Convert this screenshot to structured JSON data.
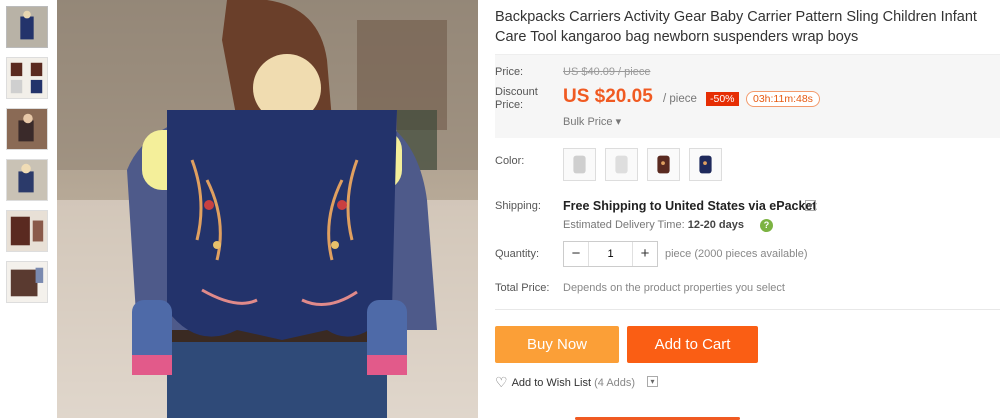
{
  "product": {
    "title": "Backpacks Carriers Activity Gear Baby Carrier Pattern Sling Children Infant Care Tool kangaroo bag newborn suspenders wrap boys"
  },
  "price": {
    "label": "Price:",
    "original": "US $40.09 / piece",
    "discount_label": "Discount Price:",
    "discount": "US $20.05",
    "unit": "/ piece",
    "off": "-50%",
    "timer": "03h:11m:48s",
    "bulk": "Bulk Price ▾"
  },
  "color": {
    "label": "Color:",
    "swatches": [
      {
        "name": "light-gray",
        "hex": "#cfcfcf"
      },
      {
        "name": "gray-white",
        "hex": "#dedede"
      },
      {
        "name": "brown",
        "hex": "#5a2a20"
      },
      {
        "name": "navy",
        "hex": "#1f2a5c"
      }
    ]
  },
  "shipping": {
    "label": "Shipping:",
    "main": "Free Shipping to United States via ePacket",
    "estimate_prefix": "Estimated Delivery Time:",
    "estimate_days": "12-20 days"
  },
  "quantity": {
    "label": "Quantity:",
    "value": "1",
    "minus": "−",
    "plus": "+",
    "available": "piece (2000 pieces available)"
  },
  "total": {
    "label": "Total Price:",
    "value": "Depends on the product properties you select"
  },
  "actions": {
    "buy_now": "Buy Now",
    "add_to_cart": "Add to Cart",
    "wishlist": "Add to Wish List",
    "wishlist_count": "(4 Adds)"
  },
  "colors": {
    "accent": "#f05a22",
    "buy_now_bg": "#fb9f37",
    "add_to_cart_bg": "#fa5e14",
    "off_badge_bg": "#e62e04",
    "carrier_navy": "#23336b"
  }
}
